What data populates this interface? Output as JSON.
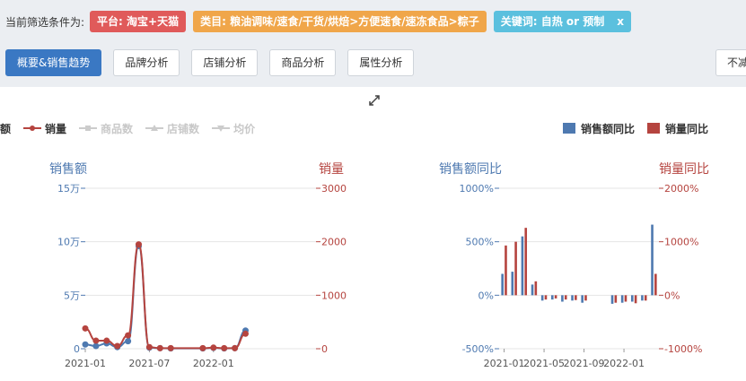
{
  "filter": {
    "label": "当前筛选条件为:",
    "tags": [
      {
        "text": "平台: 淘宝+天猫",
        "color": "#e05a5a"
      },
      {
        "text": "类目: 粮油调味/速食/干货/烘焙>方便速食/速冻食品>粽子",
        "color": "#f0a64a"
      },
      {
        "text": "关键词: 自热 or 预制",
        "color": "#5bc0de",
        "close": "x"
      }
    ]
  },
  "tabs": [
    {
      "label": "概要&销售趋势",
      "active": true
    },
    {
      "label": "品牌分析"
    },
    {
      "label": "店铺分析"
    },
    {
      "label": "商品分析"
    },
    {
      "label": "属性分析"
    }
  ],
  "right_button": {
    "label": "不减"
  },
  "legend_left": [
    {
      "label": "额",
      "active": true
    },
    {
      "label": "销量",
      "active": true
    },
    {
      "label": "商品数",
      "active": false
    },
    {
      "label": "店铺数",
      "active": false
    },
    {
      "label": "均价",
      "active": false
    }
  ],
  "legend_right": [
    {
      "label": "销售额同比",
      "color": "#4e79b0"
    },
    {
      "label": "销量同比",
      "color": "#b5443f"
    }
  ],
  "colors": {
    "blue": "#4e79b0",
    "red": "#b5443f"
  },
  "chart_data": [
    {
      "type": "line",
      "left_axis_title": "销售额",
      "right_axis_title": "销量",
      "left_ticks": [
        "15万",
        "10万",
        "5万",
        "0"
      ],
      "right_ticks": [
        "3000",
        "2000",
        "1000",
        "0"
      ],
      "x_ticks": [
        "2021-01",
        "2021-07",
        "2022-01"
      ],
      "ylim_left": [
        0,
        150000
      ],
      "ylim_right": [
        0,
        3000
      ],
      "series": [
        {
          "name": "销售额",
          "axis": "left",
          "color": "#4e79b0",
          "points": [
            [
              0,
              4000
            ],
            [
              1,
              2500
            ],
            [
              2,
              5000
            ],
            [
              3,
              1500
            ],
            [
              4,
              7000
            ],
            [
              5,
              96000
            ],
            [
              6,
              1000
            ],
            [
              7,
              500
            ],
            [
              8,
              300
            ],
            [
              11,
              300
            ],
            [
              12,
              800
            ],
            [
              13,
              300
            ],
            [
              14,
              500
            ],
            [
              15,
              17000
            ]
          ]
        },
        {
          "name": "销量",
          "axis": "right",
          "color": "#b5443f",
          "points": [
            [
              0,
              380
            ],
            [
              1,
              150
            ],
            [
              2,
              150
            ],
            [
              3,
              50
            ],
            [
              4,
              250
            ],
            [
              5,
              1950
            ],
            [
              6,
              30
            ],
            [
              7,
              10
            ],
            [
              8,
              10
            ],
            [
              11,
              10
            ],
            [
              12,
              20
            ],
            [
              13,
              10
            ],
            [
              14,
              10
            ],
            [
              15,
              280
            ]
          ]
        }
      ]
    },
    {
      "type": "bar",
      "left_axis_title": "销售额同比",
      "right_axis_title": "销量同比",
      "left_ticks": [
        "1000%",
        "500%",
        "0%",
        "-500%"
      ],
      "right_ticks": [
        "2000%",
        "1000%",
        "0%",
        "-1000%"
      ],
      "x_ticks": [
        "2021-01",
        "2021-05",
        "2021-09",
        "2022-01"
      ],
      "ylim_left": [
        -500,
        1000
      ],
      "ylim_right": [
        -1000,
        2000
      ],
      "series": [
        {
          "name": "销售额同比",
          "axis": "left",
          "color": "#4e79b0",
          "values": [
            200,
            220,
            550,
            100,
            -50,
            -40,
            -60,
            -50,
            -70,
            null,
            null,
            -80,
            -70,
            -60,
            -50,
            660
          ]
        },
        {
          "name": "销量同比",
          "axis": "right",
          "color": "#b5443f",
          "values": [
            930,
            1000,
            1260,
            260,
            -80,
            -60,
            -80,
            -90,
            -100,
            null,
            null,
            -140,
            -120,
            -150,
            -100,
            400
          ]
        }
      ]
    }
  ]
}
